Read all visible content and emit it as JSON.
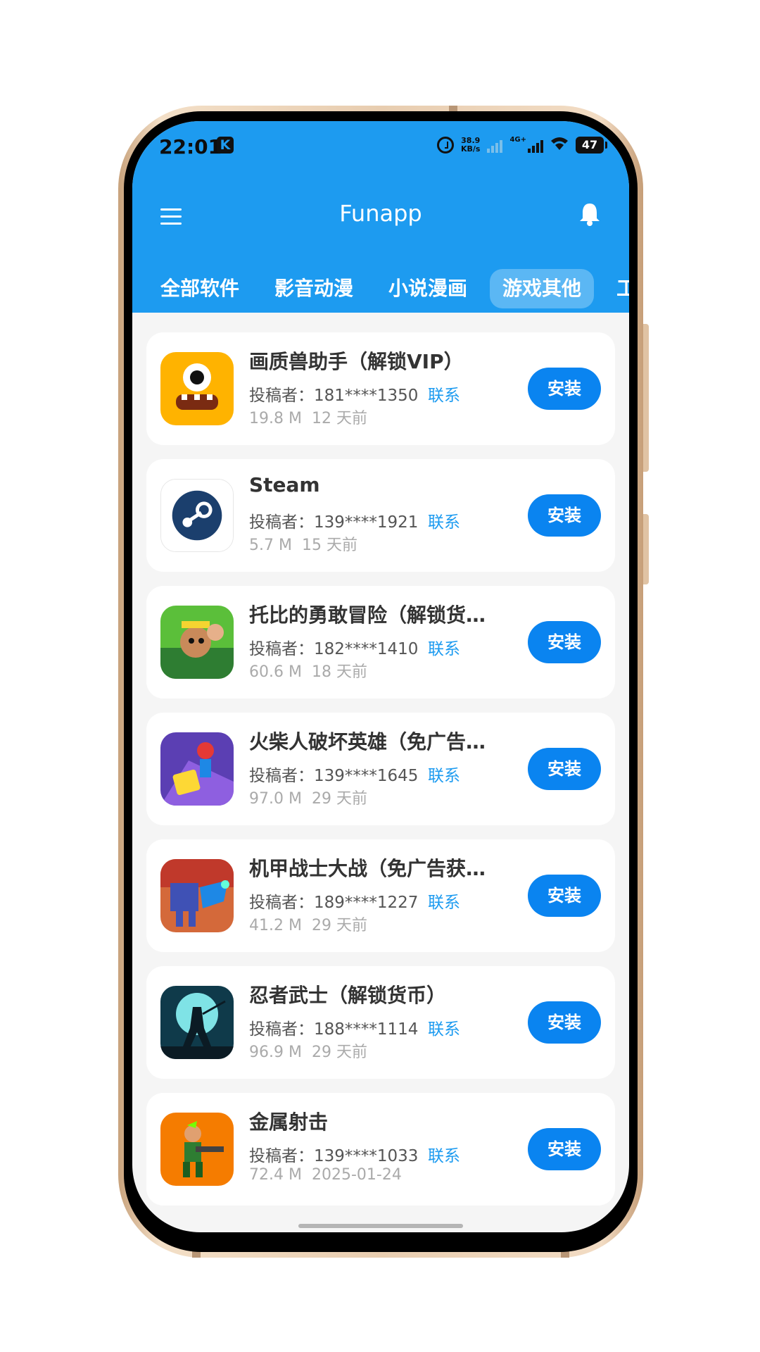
{
  "statusbar": {
    "time": "22:01",
    "badge": "K",
    "speed_value": "38.9",
    "speed_unit": "KB/s",
    "network": "4G+",
    "battery": "47"
  },
  "header": {
    "title": "Funapp",
    "menu_icon": "hamburger-menu-icon",
    "bell_icon": "bell-icon",
    "color": "#1d9bf0"
  },
  "tabs": [
    {
      "label": "全部软件",
      "active": false
    },
    {
      "label": "影音动漫",
      "active": false
    },
    {
      "label": "小说漫画",
      "active": false
    },
    {
      "label": "游戏其他",
      "active": true
    },
    {
      "label": "工",
      "active": false
    }
  ],
  "apps": [
    {
      "name": "画质兽助手（解锁VIP）",
      "uploader": "投稿者：181****1350",
      "contact": "联系",
      "size": "19.8 M",
      "date": "12 天前",
      "install": "安装",
      "icon": "monster-app-icon"
    },
    {
      "name": "Steam",
      "uploader": "投稿者：139****1921",
      "contact": "联系",
      "size": "5.7 M",
      "date": "15 天前",
      "install": "安装",
      "icon": "steam-app-icon"
    },
    {
      "name": "托比的勇敢冒险（解锁货…",
      "uploader": "投稿者：182****1410",
      "contact": "联系",
      "size": "60.6 M",
      "date": "18 天前",
      "install": "安装",
      "icon": "toby-adventure-app-icon"
    },
    {
      "name": "火柴人破坏英雄（免广告…",
      "uploader": "投稿者：139****1645",
      "contact": "联系",
      "size": "97.0 M",
      "date": "29 天前",
      "install": "安装",
      "icon": "stickman-hero-app-icon"
    },
    {
      "name": "机甲战士大战（免广告获…",
      "uploader": "投稿者：189****1227",
      "contact": "联系",
      "size": "41.2 M",
      "date": "29 天前",
      "install": "安装",
      "icon": "mech-warrior-app-icon"
    },
    {
      "name": "忍者武士（解锁货币）",
      "uploader": "投稿者：188****1114",
      "contact": "联系",
      "size": "96.9 M",
      "date": "29 天前",
      "install": "安装",
      "icon": "ninja-warrior-app-icon"
    },
    {
      "name": "金属射击",
      "uploader": "投稿者：139****1033",
      "contact": "联系",
      "size": "72.4 M",
      "date": "2025-01-24",
      "install": "安装",
      "icon": "metal-shooter-app-icon"
    }
  ]
}
